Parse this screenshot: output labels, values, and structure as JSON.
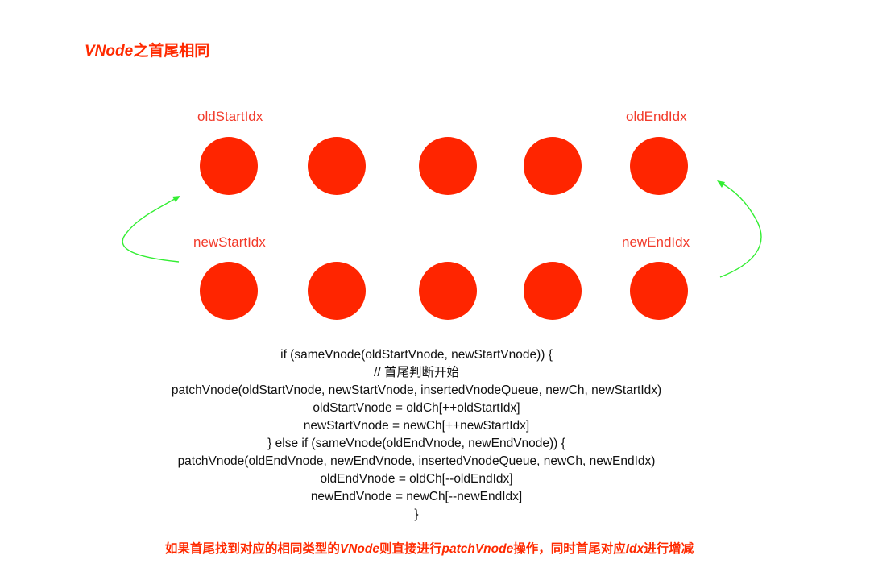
{
  "title": {
    "part_italic": "VNode",
    "part_rest": "之首尾相同"
  },
  "pointers": {
    "old_start": "oldStartIdx",
    "old_end": "oldEndIdx",
    "new_start": "newStartIdx",
    "new_end": "newEndIdx"
  },
  "nodes": {
    "old_count": 5,
    "new_count": 5,
    "color": "#ff2500"
  },
  "arrows": {
    "color": "#33ee33"
  },
  "code": {
    "lines": [
      "if (sameVnode(oldStartVnode, newStartVnode)) {",
      "// 首尾判断开始",
      "patchVnode(oldStartVnode, newStartVnode, insertedVnodeQueue, newCh, newStartIdx)",
      "oldStartVnode = oldCh[++oldStartIdx]",
      "newStartVnode = newCh[++newStartIdx]",
      "} else if (sameVnode(oldEndVnode, newEndVnode)) {",
      "patchVnode(oldEndVnode, newEndVnode, insertedVnodeQueue, newCh, newEndIdx)",
      "oldEndVnode = oldCh[--oldEndIdx]",
      "newEndVnode = newCh[--newEndIdx]",
      "}"
    ]
  },
  "caption": {
    "p1": "如果首尾找到对应的相同类型的",
    "p2": "VNode",
    "p3": "则直接进行",
    "p4": "patchVnode",
    "p5": "操作，同时首尾对应",
    "p6": "Idx",
    "p7": "进行增减"
  }
}
